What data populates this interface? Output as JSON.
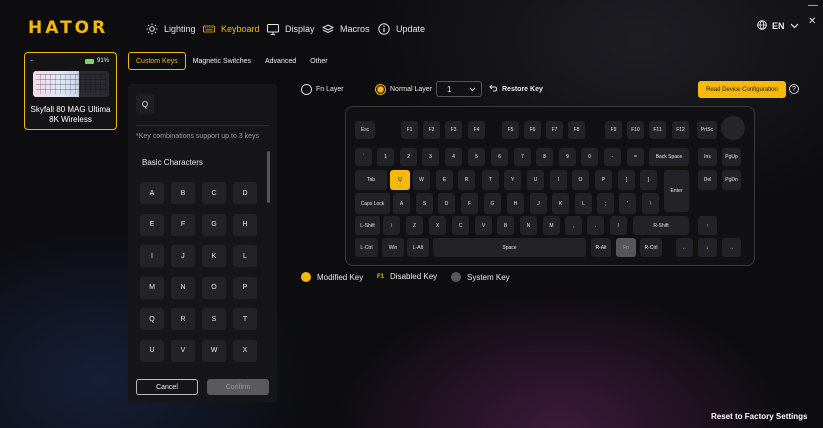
{
  "brand": {
    "logo": "HATOR",
    "accent": "#f5b90c"
  },
  "nav": [
    {
      "label": "Lighting",
      "icon": "sun-icon"
    },
    {
      "label": "Keyboard",
      "icon": "keyboard-icon",
      "active": true
    },
    {
      "label": "Display",
      "icon": "monitor-icon"
    },
    {
      "label": "Macros",
      "icon": "layers-icon"
    },
    {
      "label": "Update",
      "icon": "info-icon"
    }
  ],
  "language": {
    "value": "EN",
    "icon": "globe-icon"
  },
  "window": {
    "minimize": "—",
    "close": "✕"
  },
  "device": {
    "battery": "91%",
    "name": "Skyfall 80 MAG Ultima 8K Wireless"
  },
  "tabs": [
    "Custom Keys",
    "Magnetic Switches",
    "Advanced",
    "Other"
  ],
  "panel": {
    "search_value": "Q",
    "note": "*Key combinations support up to 3 keys",
    "section": "Basic Characters",
    "keys": [
      "A",
      "B",
      "C",
      "D",
      "E",
      "F",
      "G",
      "H",
      "I",
      "J",
      "K",
      "L",
      "M",
      "N",
      "O",
      "P",
      "Q",
      "R",
      "S",
      "T",
      "U",
      "V",
      "W",
      "X"
    ],
    "cancel": "Cancel",
    "confirm": "Confirm"
  },
  "layers": {
    "fn": "Fn Layer",
    "normal": "Normal Layer",
    "selected": "1",
    "restore": "Restore Key"
  },
  "read_config": "Read Device Configuration",
  "help": "?",
  "keyboard_rows": [
    [
      "Esc",
      "F1",
      "F2",
      "F3",
      "F4",
      "F5",
      "F6",
      "F7",
      "F8",
      "F9",
      "F10",
      "F11",
      "F12",
      "PrtSc"
    ],
    [
      "`",
      "1",
      "2",
      "3",
      "4",
      "5",
      "6",
      "7",
      "8",
      "9",
      "0",
      "-",
      "=",
      "Back Space",
      "Ins",
      "PgUp"
    ],
    [
      "Tab",
      "Q",
      "W",
      "E",
      "R",
      "T",
      "Y",
      "U",
      "I",
      "O",
      "P",
      "[",
      "]",
      "Enter",
      "Del",
      "PgDn"
    ],
    [
      "Caps Lock",
      "A",
      "S",
      "D",
      "F",
      "G",
      "H",
      "J",
      "K",
      "L",
      ";",
      "'",
      "\\"
    ],
    [
      "L-Shift",
      "\\",
      "Z",
      "X",
      "C",
      "V",
      "B",
      "N",
      "M",
      ",",
      ".",
      "/",
      "R-Shift",
      "↑"
    ],
    [
      "L-Ctrl",
      "Win",
      "L-Alt",
      "Space",
      "R-Alt",
      "Fn",
      "R-Ctrl",
      "←",
      "↓",
      "→"
    ]
  ],
  "legend": {
    "modified": "Modified Key",
    "disabled_marker": "F1",
    "disabled": "Disabled Key",
    "system": "System Key",
    "colors": {
      "modified": "#f5b90c",
      "disabled": "#f5b90c",
      "system": "#57575b"
    }
  },
  "reset": "Reset to Factory Settings"
}
